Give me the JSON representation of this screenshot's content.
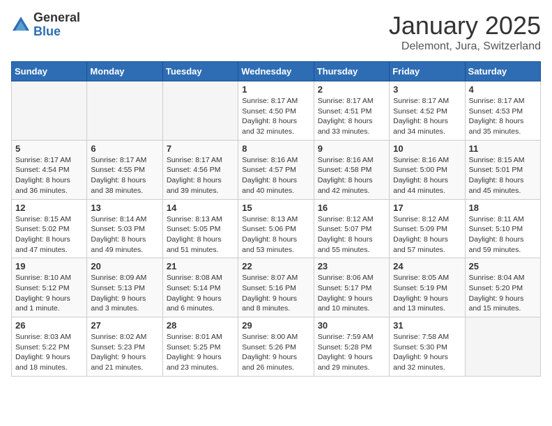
{
  "header": {
    "logo_general": "General",
    "logo_blue": "Blue",
    "month_title": "January 2025",
    "location": "Delemont, Jura, Switzerland"
  },
  "days": [
    "Sunday",
    "Monday",
    "Tuesday",
    "Wednesday",
    "Thursday",
    "Friday",
    "Saturday"
  ],
  "weeks": [
    [
      {
        "date": "",
        "info": ""
      },
      {
        "date": "",
        "info": ""
      },
      {
        "date": "",
        "info": ""
      },
      {
        "date": "1",
        "info": "Sunrise: 8:17 AM\nSunset: 4:50 PM\nDaylight: 8 hours\nand 32 minutes."
      },
      {
        "date": "2",
        "info": "Sunrise: 8:17 AM\nSunset: 4:51 PM\nDaylight: 8 hours\nand 33 minutes."
      },
      {
        "date": "3",
        "info": "Sunrise: 8:17 AM\nSunset: 4:52 PM\nDaylight: 8 hours\nand 34 minutes."
      },
      {
        "date": "4",
        "info": "Sunrise: 8:17 AM\nSunset: 4:53 PM\nDaylight: 8 hours\nand 35 minutes."
      }
    ],
    [
      {
        "date": "5",
        "info": "Sunrise: 8:17 AM\nSunset: 4:54 PM\nDaylight: 8 hours\nand 36 minutes."
      },
      {
        "date": "6",
        "info": "Sunrise: 8:17 AM\nSunset: 4:55 PM\nDaylight: 8 hours\nand 38 minutes."
      },
      {
        "date": "7",
        "info": "Sunrise: 8:17 AM\nSunset: 4:56 PM\nDaylight: 8 hours\nand 39 minutes."
      },
      {
        "date": "8",
        "info": "Sunrise: 8:16 AM\nSunset: 4:57 PM\nDaylight: 8 hours\nand 40 minutes."
      },
      {
        "date": "9",
        "info": "Sunrise: 8:16 AM\nSunset: 4:58 PM\nDaylight: 8 hours\nand 42 minutes."
      },
      {
        "date": "10",
        "info": "Sunrise: 8:16 AM\nSunset: 5:00 PM\nDaylight: 8 hours\nand 44 minutes."
      },
      {
        "date": "11",
        "info": "Sunrise: 8:15 AM\nSunset: 5:01 PM\nDaylight: 8 hours\nand 45 minutes."
      }
    ],
    [
      {
        "date": "12",
        "info": "Sunrise: 8:15 AM\nSunset: 5:02 PM\nDaylight: 8 hours\nand 47 minutes."
      },
      {
        "date": "13",
        "info": "Sunrise: 8:14 AM\nSunset: 5:03 PM\nDaylight: 8 hours\nand 49 minutes."
      },
      {
        "date": "14",
        "info": "Sunrise: 8:13 AM\nSunset: 5:05 PM\nDaylight: 8 hours\nand 51 minutes."
      },
      {
        "date": "15",
        "info": "Sunrise: 8:13 AM\nSunset: 5:06 PM\nDaylight: 8 hours\nand 53 minutes."
      },
      {
        "date": "16",
        "info": "Sunrise: 8:12 AM\nSunset: 5:07 PM\nDaylight: 8 hours\nand 55 minutes."
      },
      {
        "date": "17",
        "info": "Sunrise: 8:12 AM\nSunset: 5:09 PM\nDaylight: 8 hours\nand 57 minutes."
      },
      {
        "date": "18",
        "info": "Sunrise: 8:11 AM\nSunset: 5:10 PM\nDaylight: 8 hours\nand 59 minutes."
      }
    ],
    [
      {
        "date": "19",
        "info": "Sunrise: 8:10 AM\nSunset: 5:12 PM\nDaylight: 9 hours\nand 1 minute."
      },
      {
        "date": "20",
        "info": "Sunrise: 8:09 AM\nSunset: 5:13 PM\nDaylight: 9 hours\nand 3 minutes."
      },
      {
        "date": "21",
        "info": "Sunrise: 8:08 AM\nSunset: 5:14 PM\nDaylight: 9 hours\nand 6 minutes."
      },
      {
        "date": "22",
        "info": "Sunrise: 8:07 AM\nSunset: 5:16 PM\nDaylight: 9 hours\nand 8 minutes."
      },
      {
        "date": "23",
        "info": "Sunrise: 8:06 AM\nSunset: 5:17 PM\nDaylight: 9 hours\nand 10 minutes."
      },
      {
        "date": "24",
        "info": "Sunrise: 8:05 AM\nSunset: 5:19 PM\nDaylight: 9 hours\nand 13 minutes."
      },
      {
        "date": "25",
        "info": "Sunrise: 8:04 AM\nSunset: 5:20 PM\nDaylight: 9 hours\nand 15 minutes."
      }
    ],
    [
      {
        "date": "26",
        "info": "Sunrise: 8:03 AM\nSunset: 5:22 PM\nDaylight: 9 hours\nand 18 minutes."
      },
      {
        "date": "27",
        "info": "Sunrise: 8:02 AM\nSunset: 5:23 PM\nDaylight: 9 hours\nand 21 minutes."
      },
      {
        "date": "28",
        "info": "Sunrise: 8:01 AM\nSunset: 5:25 PM\nDaylight: 9 hours\nand 23 minutes."
      },
      {
        "date": "29",
        "info": "Sunrise: 8:00 AM\nSunset: 5:26 PM\nDaylight: 9 hours\nand 26 minutes."
      },
      {
        "date": "30",
        "info": "Sunrise: 7:59 AM\nSunset: 5:28 PM\nDaylight: 9 hours\nand 29 minutes."
      },
      {
        "date": "31",
        "info": "Sunrise: 7:58 AM\nSunset: 5:30 PM\nDaylight: 9 hours\nand 32 minutes."
      },
      {
        "date": "",
        "info": ""
      }
    ]
  ]
}
